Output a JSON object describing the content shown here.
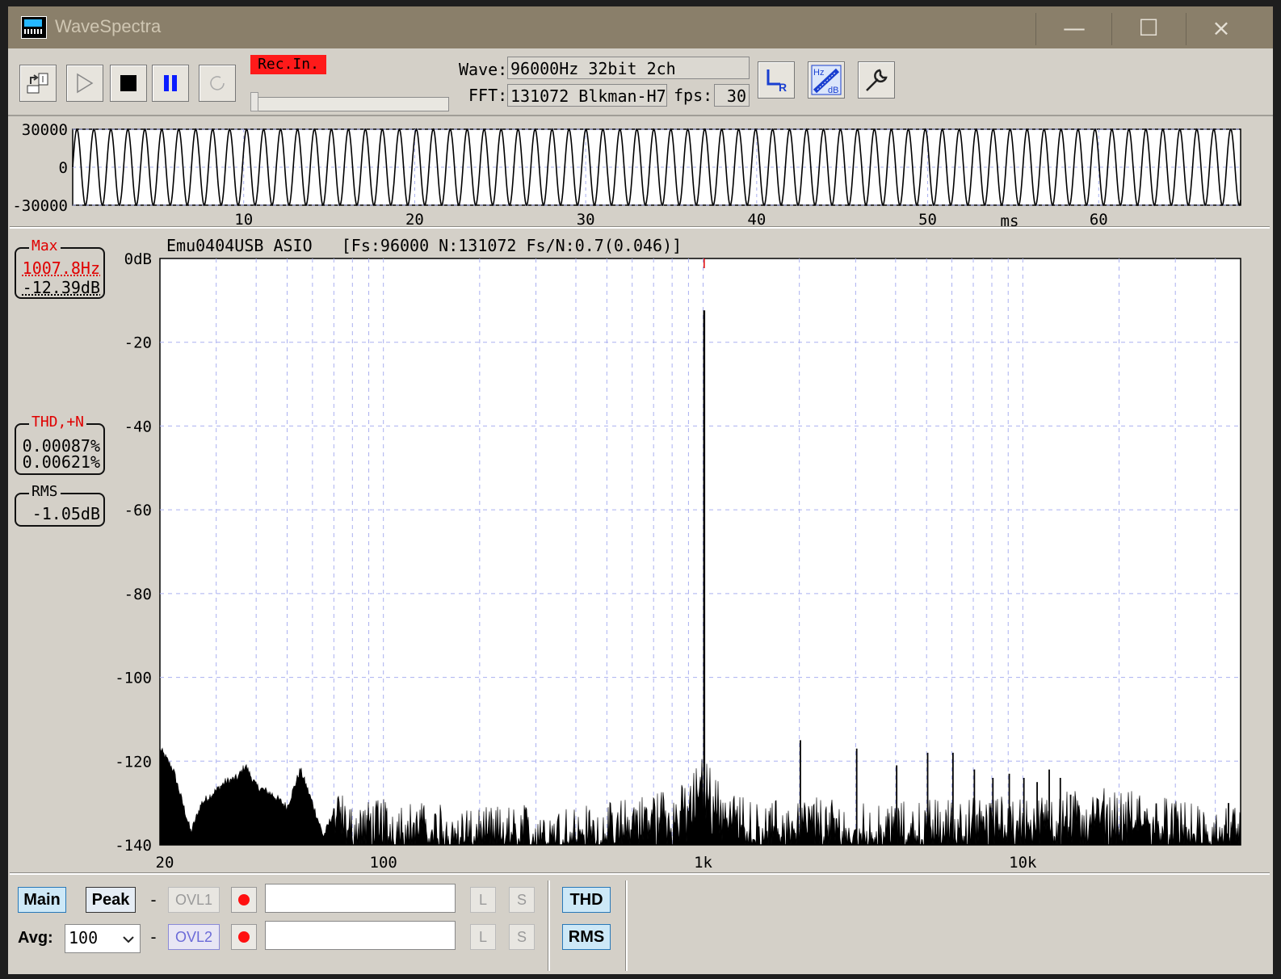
{
  "window": {
    "title": "WaveSpectra",
    "controls": [
      "minimize",
      "maximize",
      "close"
    ]
  },
  "titlebar": {
    "minimize_glyph": "—",
    "maximize_glyph": "☐",
    "close_glyph": "×"
  },
  "toolbar": {
    "rec_in_label": "Rec.In.",
    "rec_level": 0.0,
    "wave_label": "Wave:",
    "wave_value": "96000Hz 32bit 2ch",
    "fft_label": "FFT:",
    "fft_value": "131072 Blkman-H7",
    "fps_label": "fps:",
    "fps_value": "30",
    "icons": [
      "open-file-icon",
      "play-icon",
      "stop-icon",
      "pause-icon",
      "loop-icon",
      "lr-channel-icon",
      "hz-db-scale-icon",
      "settings-wrench-icon"
    ]
  },
  "waveform": {
    "y_ticks": [
      "30000",
      "0",
      "-30000"
    ],
    "x_ticks": [
      "10",
      "20",
      "30",
      "40",
      "50",
      "60"
    ],
    "x_unit": "ms"
  },
  "spectrum": {
    "header": "Emu0404USB ASIO   [Fs:96000 N:131072 Fs/N:0.7(0.046)]",
    "max_box": {
      "title": "Max",
      "freq": "1007.8Hz",
      "level": "-12.39dB"
    },
    "thd_box": {
      "title": "THD,+N",
      "thd": "0.00087%",
      "thdn": "0.00621%"
    },
    "rms_box": {
      "title": "RMS",
      "value": "-1.05dB"
    },
    "y_ticks": [
      "0dB",
      "-20",
      "-40",
      "-60",
      "-80",
      "-100",
      "-120",
      "-140"
    ],
    "x_ticks": [
      "20",
      "100",
      "1k",
      "10k"
    ]
  },
  "chart_data": [
    {
      "type": "line",
      "title": "",
      "xlabel": "ms",
      "ylabel": "",
      "xlim": [
        0,
        68.3
      ],
      "ylim": [
        -30000,
        30000
      ],
      "frequency_hz": 1007.8,
      "amplitude": 30000,
      "x_ticks": [
        10,
        20,
        30,
        40,
        50,
        60
      ],
      "y_ticks": [
        30000,
        0,
        -30000
      ]
    },
    {
      "type": "line",
      "title": "Emu0404USB ASIO   [Fs:96000 N:131072 Fs/N:0.7(0.046)]",
      "xlabel": "",
      "ylabel": "",
      "xscale": "log",
      "xlim": [
        20,
        48000
      ],
      "ylim": [
        -140,
        0
      ],
      "x_ticks": [
        20,
        100,
        1000,
        10000
      ],
      "y_ticks": [
        0,
        -20,
        -40,
        -60,
        -80,
        -100,
        -120,
        -140
      ],
      "grid": true,
      "noise_floor": {
        "x": [
          20,
          22,
          25,
          27,
          30,
          32,
          35,
          37,
          40,
          45,
          50,
          55,
          60,
          65,
          70,
          80,
          100,
          150,
          200,
          300,
          500,
          700,
          900,
          1000,
          1100,
          1500,
          2000,
          3000,
          5000,
          10000,
          20000,
          30000,
          40000,
          48000
        ],
        "y": [
          -117,
          -122,
          -137,
          -130,
          -127,
          -125,
          -124,
          -121,
          -126,
          -128,
          -131,
          -122,
          -130,
          -138,
          -132,
          -137,
          -136,
          -137,
          -138,
          -137,
          -137,
          -134,
          -132,
          -125,
          -131,
          -137,
          -135,
          -137,
          -136,
          -135,
          -133,
          -136,
          -138,
          -138
        ]
      },
      "peaks": [
        {
          "freq": 1007.8,
          "level": -12.39
        },
        {
          "freq": 2015,
          "level": -115
        },
        {
          "freq": 3023,
          "level": -117
        },
        {
          "freq": 4031,
          "level": -121
        },
        {
          "freq": 5039,
          "level": -118
        },
        {
          "freq": 6047,
          "level": -118
        },
        {
          "freq": 7055,
          "level": -122
        },
        {
          "freq": 8062,
          "level": -124
        },
        {
          "freq": 9070,
          "level": -123
        },
        {
          "freq": 10078,
          "level": -124
        },
        {
          "freq": 11086,
          "level": -125
        },
        {
          "freq": 12094,
          "level": -122
        },
        {
          "freq": 13102,
          "level": -124
        },
        {
          "freq": 14110,
          "level": -128
        },
        {
          "freq": 44000,
          "level": -130
        }
      ]
    }
  ],
  "bottom": {
    "main_label": "Main",
    "peak_label": "Peak",
    "ovl1_label": "OVL1",
    "ovl2_label": "OVL2",
    "avg_label": "Avg:",
    "avg_value": "100",
    "l_label": "L",
    "s_label": "S",
    "thd_label": "THD",
    "rms_label": "RMS",
    "dash": "-",
    "ovl1_text": "",
    "ovl2_text": ""
  }
}
